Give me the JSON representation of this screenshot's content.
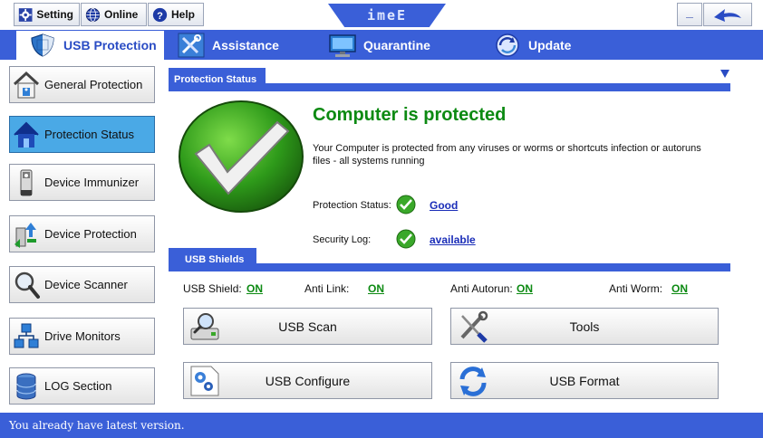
{
  "topbar": {
    "setting_label": "Setting",
    "online_label": "Online",
    "help_label": "Help",
    "logo_text": "imeE",
    "minimize_label": "_"
  },
  "tabs": [
    {
      "label": "USB Protection",
      "active": true
    },
    {
      "label": "Assistance",
      "active": false
    },
    {
      "label": "Quarantine",
      "active": false
    },
    {
      "label": "Update",
      "active": false
    }
  ],
  "sidebar": {
    "items": [
      {
        "label": "General Protection",
        "icon": "house-shield-icon"
      },
      {
        "label": "Protection Status",
        "icon": "house-icon",
        "active": true
      },
      {
        "label": "Device Immunizer",
        "icon": "usb-drive-icon"
      },
      {
        "label": "Device Protection",
        "icon": "usb-arrows-icon"
      },
      {
        "label": "Device Scanner",
        "icon": "magnifier-icon"
      },
      {
        "label": "Drive Monitors",
        "icon": "network-icon"
      },
      {
        "label": "LOG Section",
        "icon": "database-icon"
      }
    ]
  },
  "protection": {
    "section_label": "Protection Status",
    "title": "Computer is protected",
    "description": "Your Computer is protected from any viruses or worms or shortcuts infection or autoruns files - all systems running",
    "status_label": "Protection Status:",
    "status_value": "Good",
    "log_label": "Security Log:",
    "log_value": "available"
  },
  "shields": {
    "section_label": "USB Shields",
    "items": [
      {
        "label": "USB Shield:",
        "value": "ON"
      },
      {
        "label": "Anti Link:",
        "value": "ON"
      },
      {
        "label": "Anti Autorun:",
        "value": "ON"
      },
      {
        "label": "Anti Worm:",
        "value": "ON"
      }
    ]
  },
  "actions": {
    "usb_scan": "USB Scan",
    "tools": "Tools",
    "usb_configure": "USB Configure",
    "usb_format": "USB Format"
  },
  "statusbar": {
    "message": "You already have latest version."
  },
  "colors": {
    "accent": "#3a5fd8",
    "ok_green": "#0c8a12",
    "link_blue": "#1a2db8",
    "active_item": "#4aa9e6"
  }
}
